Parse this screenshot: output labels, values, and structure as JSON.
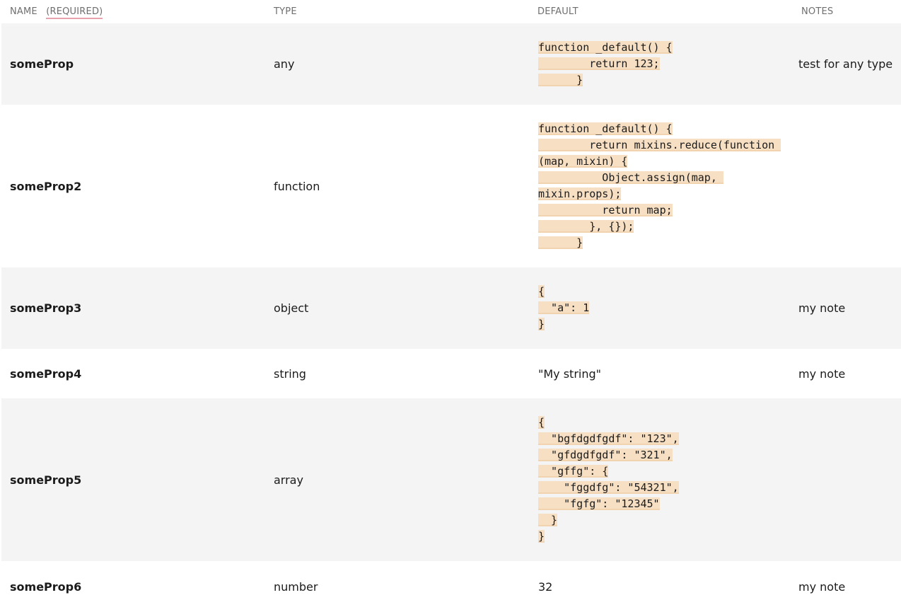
{
  "header": {
    "name": "NAME",
    "required": "(REQUIRED)",
    "type": "TYPE",
    "default": "DEFAULT",
    "notes": "NOTES"
  },
  "rows": [
    {
      "name": "someProp",
      "type": "any",
      "default_code": [
        "function _default() {",
        "        return 123;",
        "      }"
      ],
      "notes": "test for any type"
    },
    {
      "name": "someProp2",
      "type": "function",
      "default_code": [
        "function _default() {",
        "        return mixins.reduce(function ",
        "(map, mixin) {",
        "          Object.assign(map, ",
        "mixin.props);",
        "          return map;",
        "        }, {});",
        "      }"
      ],
      "notes": ""
    },
    {
      "name": "someProp3",
      "type": "object",
      "default_code": [
        "{",
        "  \"a\": 1",
        "}"
      ],
      "notes": "my note"
    },
    {
      "name": "someProp4",
      "type": "string",
      "default_text": "\"My string\"",
      "notes": "my note"
    },
    {
      "name": "someProp5",
      "type": "array",
      "default_code": [
        "{",
        "  \"bgfdgdfgdf\": \"123\",",
        "  \"gfdgdfgdf\": \"321\",",
        "  \"gffg\": {",
        "    \"fggdfg\": \"54321\",",
        "    \"fgfg\": \"12345\"",
        "  }",
        "}"
      ],
      "notes": ""
    },
    {
      "name": "someProp6",
      "type": "number",
      "default_text": "32",
      "notes": "my note"
    }
  ]
}
